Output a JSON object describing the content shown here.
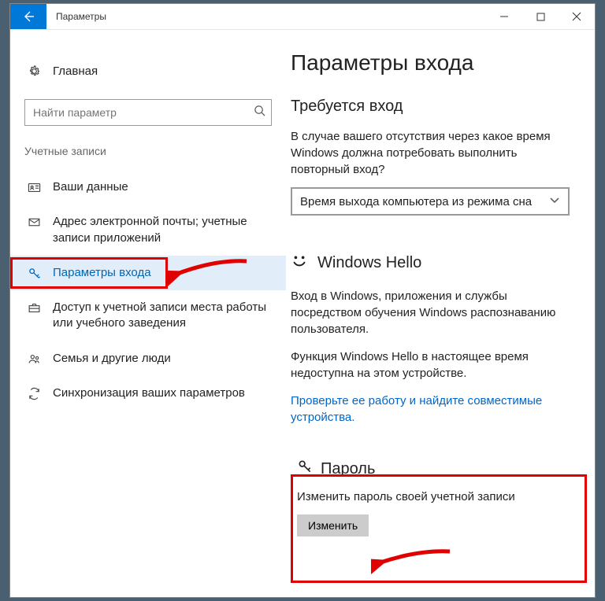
{
  "titlebar": {
    "title": "Параметры"
  },
  "sidebar": {
    "home_label": "Главная",
    "search_placeholder": "Найти параметр",
    "group_header": "Учетные записи",
    "items": [
      {
        "label": "Ваши данные"
      },
      {
        "label": "Адрес электронной почты; учетные записи приложений"
      },
      {
        "label": "Параметры входа"
      },
      {
        "label": "Доступ к учетной записи места работы или учебного заведения"
      },
      {
        "label": "Семья и другие люди"
      },
      {
        "label": "Синхронизация ваших параметров"
      }
    ]
  },
  "main": {
    "title": "Параметры входа",
    "require_signin": {
      "heading": "Требуется вход",
      "text": "В случае вашего отсутствия через какое время Windows должна потребовать выполнить повторный вход?",
      "dropdown_value": "Время выхода компьютера из режима сна"
    },
    "hello": {
      "heading": "Windows Hello",
      "text1": "Вход в Windows, приложения и службы посредством обучения Windows распознаванию пользователя.",
      "text2": "Функция Windows Hello в настоящее время недоступна на этом устройстве.",
      "link": "Проверьте ее работу и найдите совместимые устройства."
    },
    "password": {
      "heading": "Пароль",
      "text": "Изменить пароль своей учетной записи",
      "button": "Изменить"
    }
  }
}
